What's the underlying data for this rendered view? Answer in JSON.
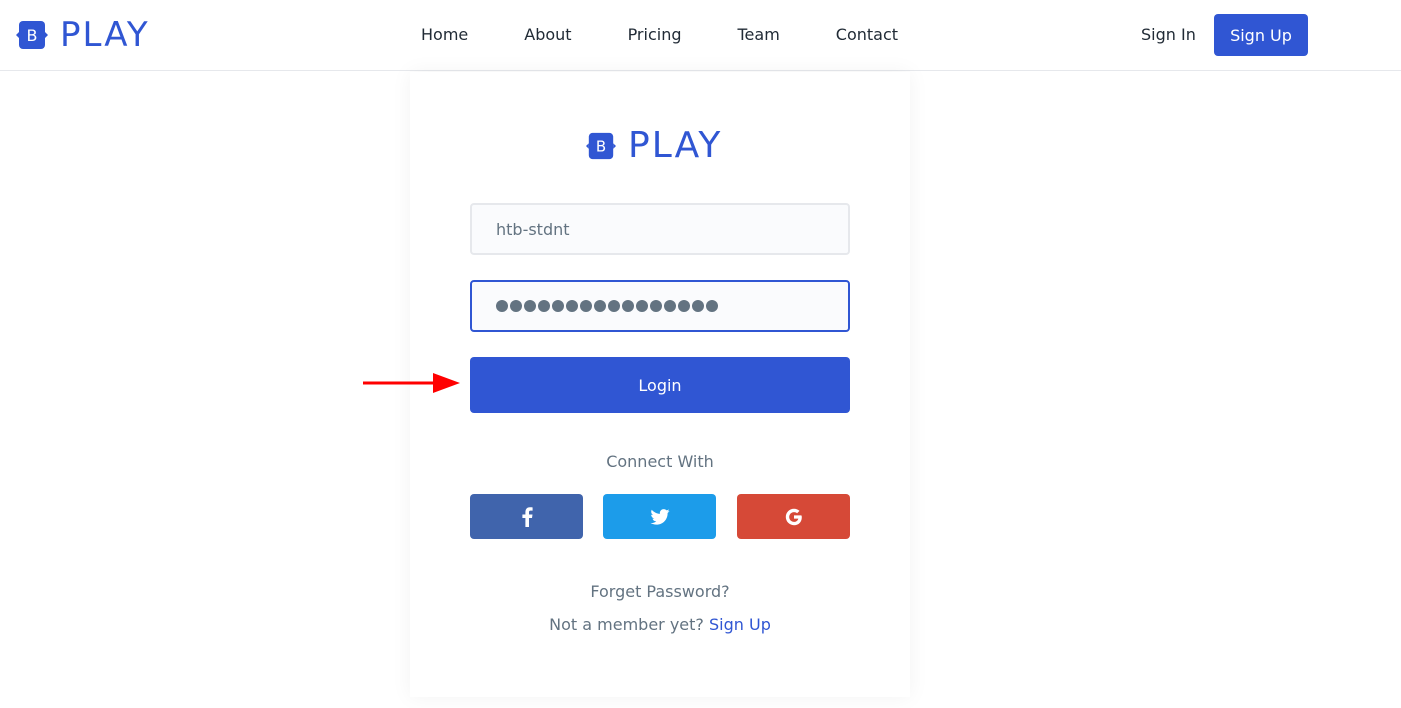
{
  "header": {
    "brand": "PLAY",
    "nav": [
      "Home",
      "About",
      "Pricing",
      "Team",
      "Contact"
    ],
    "sign_in": "Sign In",
    "sign_up": "Sign Up"
  },
  "login_card": {
    "brand": "PLAY",
    "username_value": "htb-stdnt",
    "password_mask_count": 16,
    "login_label": "Login",
    "connect_with": "Connect With",
    "social_icons": [
      "facebook-icon",
      "twitter-icon",
      "google-icon"
    ],
    "forget_password": "Forget Password?",
    "not_member": "Not a member yet?",
    "sign_up_link": "Sign Up"
  },
  "colors": {
    "primary": "#3056d3",
    "facebook": "#4064ac",
    "twitter": "#1c9cea",
    "google": "#d64937",
    "annotation_arrow": "#ff0000"
  }
}
